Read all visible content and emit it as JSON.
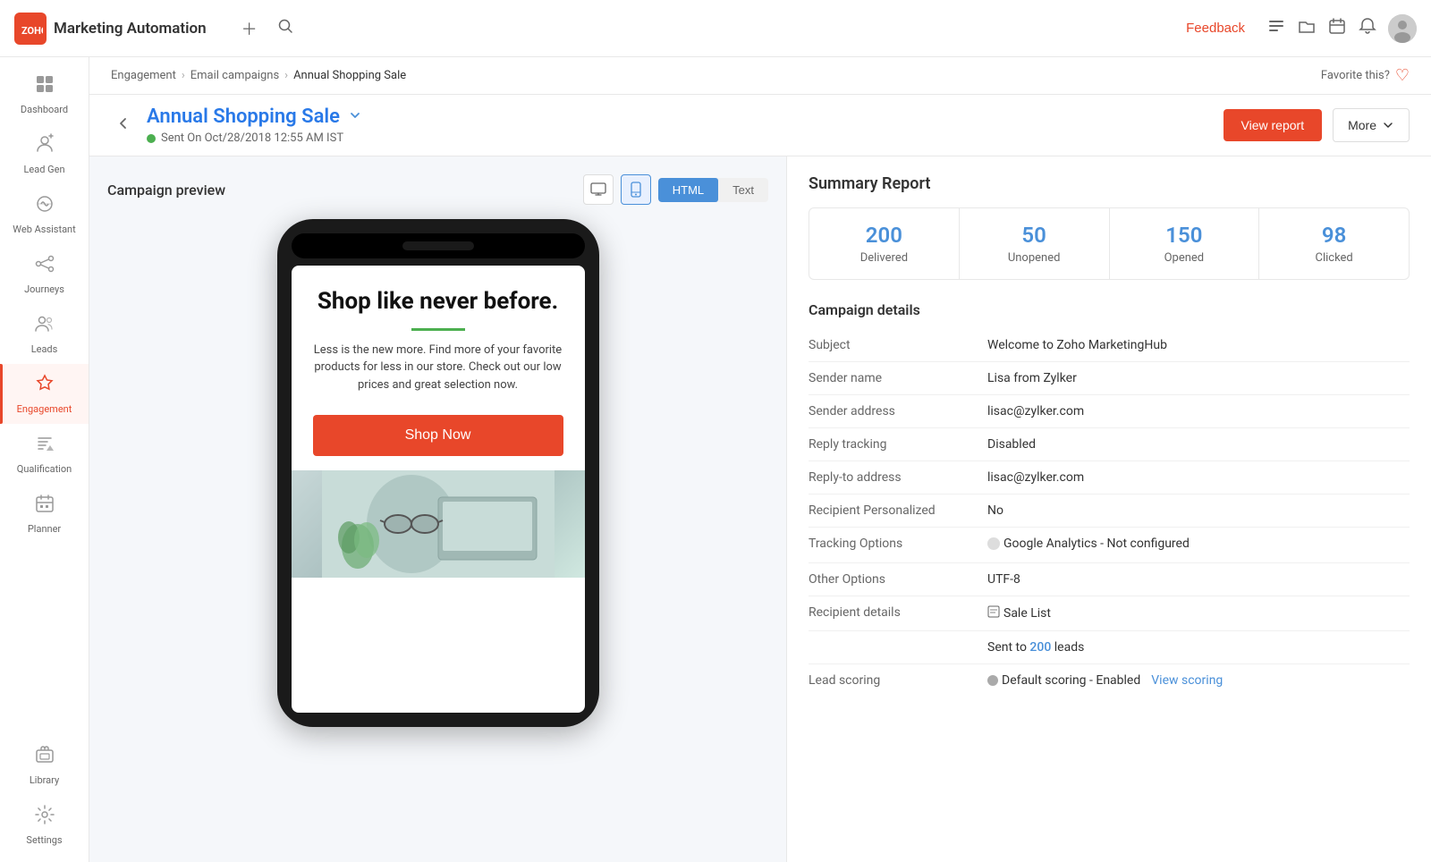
{
  "topbar": {
    "logo_text": "ZOHO",
    "title": "Marketing Automation",
    "feedback_label": "Feedback",
    "add_icon": "+",
    "search_icon": "🔍"
  },
  "breadcrumb": {
    "items": [
      "Engagement",
      "Email campaigns",
      "Annual Shopping Sale"
    ]
  },
  "page_header": {
    "title": "Annual Shopping Sale",
    "sent_info": "Sent On Oct/28/2018 12:55 AM IST",
    "view_report_label": "View report",
    "more_label": "More"
  },
  "campaign_preview": {
    "title": "Campaign preview",
    "desktop_icon": "🖥",
    "mobile_icon": "📱",
    "html_label": "HTML",
    "text_label": "Text",
    "email": {
      "headline": "Shop like never before.",
      "body_text": "Less is the new more. Find more of your favorite products for less in our store. Check out our low prices and great selection now.",
      "cta_label": "Shop Now"
    }
  },
  "summary_report": {
    "title": "Summary Report",
    "stats": [
      {
        "number": "200",
        "label": "Delivered"
      },
      {
        "number": "50",
        "label": "Unopened"
      },
      {
        "number": "150",
        "label": "Opened"
      },
      {
        "number": "98",
        "label": "Clicked"
      }
    ]
  },
  "campaign_details": {
    "title": "Campaign details",
    "rows": [
      {
        "key": "Subject",
        "value": "Welcome to Zoho MarketingHub"
      },
      {
        "key": "Sender name",
        "value": "Lisa from Zylker"
      },
      {
        "key": "Sender address",
        "value": "lisac@zylker.com"
      },
      {
        "key": "Reply tracking",
        "value": "Disabled"
      },
      {
        "key": "Reply-to address",
        "value": "lisac@zylker.com"
      },
      {
        "key": "Recipient Personalized",
        "value": "No"
      },
      {
        "key": "Tracking Options",
        "value": "Google Analytics - Not configured",
        "has_dot": true
      },
      {
        "key": "Other Options",
        "value": "UTF-8"
      },
      {
        "key": "Recipient details",
        "value": "Sale List",
        "has_icon": true
      },
      {
        "key": "",
        "value_prefix": "Sent to ",
        "value_link": "200",
        "value_suffix": " leads"
      },
      {
        "key": "Lead scoring",
        "value": "Default scoring - Enabled",
        "has_scoring_dot": true,
        "view_scoring": "View scoring"
      }
    ]
  },
  "sidebar": {
    "items": [
      {
        "id": "dashboard",
        "label": "Dashboard",
        "icon": "⊞"
      },
      {
        "id": "lead-gen",
        "label": "Lead Gen",
        "icon": "👤"
      },
      {
        "id": "web-assistant",
        "label": "Web Assistant",
        "icon": "💬"
      },
      {
        "id": "journeys",
        "label": "Journeys",
        "icon": "↗"
      },
      {
        "id": "leads",
        "label": "Leads",
        "icon": "👥"
      },
      {
        "id": "engagement",
        "label": "Engagement",
        "icon": "✦",
        "active": true
      },
      {
        "id": "qualification",
        "label": "Qualification",
        "icon": "▼"
      },
      {
        "id": "planner",
        "label": "Planner",
        "icon": "📅"
      }
    ],
    "bottom_items": [
      {
        "id": "library",
        "label": "Library",
        "icon": "🖼"
      },
      {
        "id": "settings",
        "label": "Settings",
        "icon": "⚙"
      }
    ]
  }
}
